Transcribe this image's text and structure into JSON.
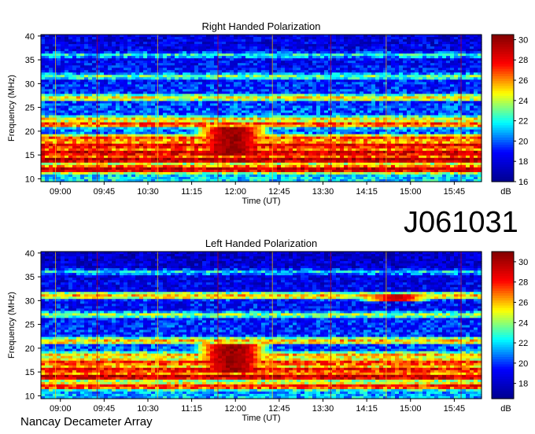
{
  "observation_id": "J061031",
  "instrument": "Nancay Decameter Array",
  "chart_data": [
    {
      "type": "heatmap",
      "title": "Right Handed Polarization",
      "xlabel": "Time (UT)",
      "ylabel": "Frequency (MHz)",
      "x_ticks": [
        "09:00",
        "09:45",
        "10:30",
        "11:15",
        "12:00",
        "12:45",
        "13:30",
        "14:15",
        "15:00",
        "15:45"
      ],
      "y_ticks": [
        10,
        15,
        20,
        25,
        30,
        35,
        40
      ],
      "ylim": [
        10,
        40
      ],
      "colorbar": {
        "label": "dB",
        "ticks": [
          16,
          18,
          20,
          22,
          24,
          26,
          28,
          30
        ],
        "range": [
          16,
          30.5
        ]
      },
      "colormap": [
        "#00008f",
        "#0000ff",
        "#00ffff",
        "#ffff00",
        "#ff0000",
        "#800000"
      ],
      "bands": [
        {
          "freq": 12,
          "level": 29
        },
        {
          "freq": 14,
          "level": 29.5
        },
        {
          "freq": 15.5,
          "level": 29
        },
        {
          "freq": 17,
          "level": 28.5
        },
        {
          "freq": 18.5,
          "level": 27
        },
        {
          "freq": 21.5,
          "level": 27
        },
        {
          "freq": 22.5,
          "level": 25
        },
        {
          "freq": 27,
          "level": 25
        },
        {
          "freq": 31.5,
          "level": 23
        },
        {
          "freq": 36,
          "level": 22
        }
      ],
      "bursts": [
        {
          "time": "11:57",
          "freq_low": 15,
          "freq_high": 21,
          "level": 30
        }
      ]
    },
    {
      "type": "heatmap",
      "title": "Left Handed Polarization",
      "xlabel": "Time (UT)",
      "ylabel": "Frequency (MHz)",
      "x_ticks": [
        "09:00",
        "09:45",
        "10:30",
        "11:15",
        "12:00",
        "12:45",
        "13:30",
        "14:15",
        "15:00",
        "15:45"
      ],
      "y_ticks": [
        10,
        15,
        20,
        25,
        30,
        35,
        40
      ],
      "ylim": [
        10,
        40
      ],
      "colorbar": {
        "label": "dB",
        "ticks": [
          18,
          20,
          22,
          24,
          26,
          28,
          30
        ],
        "range": [
          16.5,
          31
        ]
      },
      "colormap": [
        "#00008f",
        "#0000ff",
        "#00ffff",
        "#ffff00",
        "#ff0000",
        "#800000"
      ],
      "bands": [
        {
          "freq": 12,
          "level": 28
        },
        {
          "freq": 14,
          "level": 29.5
        },
        {
          "freq": 15.5,
          "level": 28.5
        },
        {
          "freq": 17,
          "level": 28
        },
        {
          "freq": 18.5,
          "level": 26
        },
        {
          "freq": 21.5,
          "level": 26
        },
        {
          "freq": 27,
          "level": 24
        },
        {
          "freq": 31,
          "level": 26
        },
        {
          "freq": 36,
          "level": 22
        }
      ],
      "bursts": [
        {
          "time": "11:57",
          "freq_low": 15,
          "freq_high": 21,
          "level": 30.5
        },
        {
          "time": "14:45",
          "freq_low": 30,
          "freq_high": 31.5,
          "level": 29
        }
      ]
    }
  ]
}
